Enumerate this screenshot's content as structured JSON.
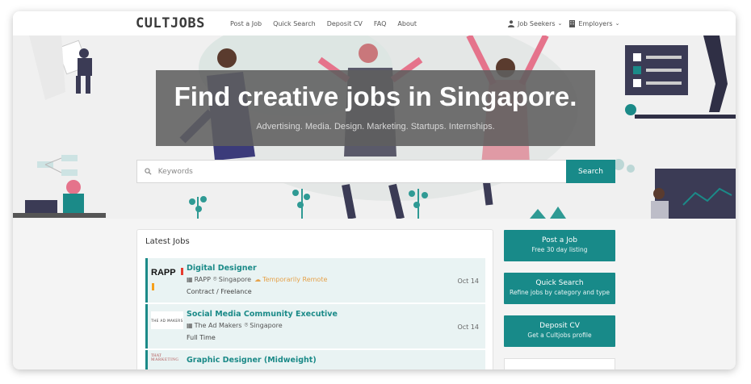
{
  "app": {
    "logo_text": "CULTJOBS"
  },
  "nav": {
    "links": [
      "Post a Job",
      "Quick Search",
      "Deposit CV",
      "FAQ",
      "About"
    ],
    "job_seekers": "Job Seekers",
    "employers": "Employers"
  },
  "hero": {
    "title": "Find creative jobs in Singapore.",
    "subtitle": "Advertising. Media. Design. Marketing. Startups. Internships."
  },
  "search": {
    "placeholder": "Keywords",
    "button": "Search"
  },
  "latest": {
    "heading": "Latest Jobs",
    "jobs": [
      {
        "logo": "RAPP",
        "title": "Digital Designer",
        "company": "RAPP",
        "location": "Singapore",
        "remote": "Temporarily Remote",
        "type": "Contract / Freelance",
        "date": "Oct 14"
      },
      {
        "logo": "THE AD MAKERS",
        "title": "Social Media Community Executive",
        "company": "The Ad Makers",
        "location": "Singapore",
        "type": "Full Time",
        "date": "Oct 14"
      },
      {
        "logo_line1": "THAT",
        "logo_line2": "MARKETING",
        "title": "Graphic Designer (Midweight)"
      }
    ]
  },
  "sidebar": {
    "post": {
      "title": "Post a Job",
      "sub": "Free 30 day listing"
    },
    "quick": {
      "title": "Quick Search",
      "sub": "Refine jobs by category and type"
    },
    "cv": {
      "title": "Deposit CV",
      "sub": "Get a Cultjobs profile"
    }
  },
  "colors": {
    "accent": "#188a89",
    "remote": "#e6a24a",
    "job_bg": "#e9f3f3"
  }
}
